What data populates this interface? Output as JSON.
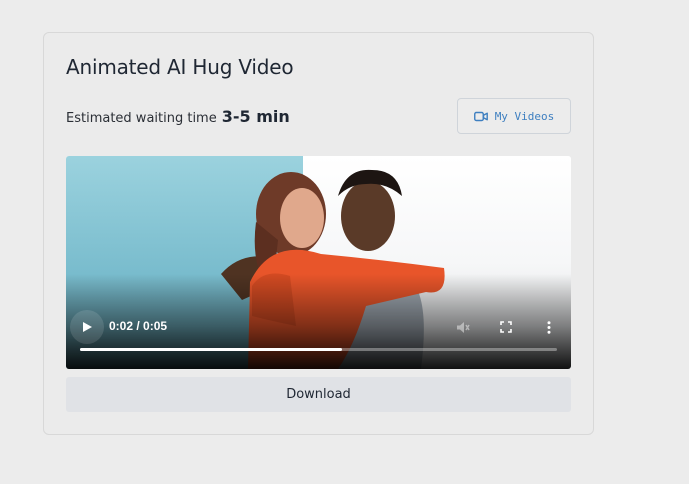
{
  "card": {
    "title": "Animated AI Hug Video",
    "wait_label": "Estimated waiting time",
    "wait_duration": "3-5 min",
    "my_videos_label": "My Videos",
    "download_label": "Download"
  },
  "player": {
    "time_display": "0:02 / 0:05",
    "progress_fraction": 0.55
  },
  "icons": {
    "my_videos": "video-camera-icon",
    "play": "play-icon",
    "mute": "volume-muted-icon",
    "fullscreen": "fullscreen-icon",
    "more": "more-vertical-icon"
  },
  "colors": {
    "accent": "#3e7fc0",
    "page_bg": "#ececec",
    "button_bg": "#e0e2e6"
  }
}
